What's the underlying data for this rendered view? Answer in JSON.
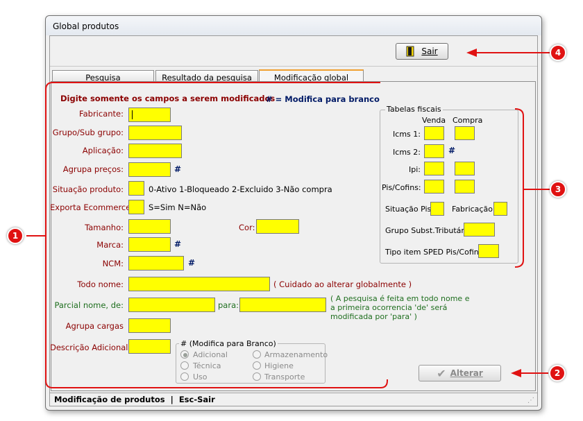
{
  "window": {
    "title": "Global produtos"
  },
  "toolbar": {
    "sair_label": "Sair"
  },
  "tabs": [
    {
      "label": "Pesquisa"
    },
    {
      "label": "Resultado da pesquisa"
    },
    {
      "label": "Modificação global"
    }
  ],
  "form": {
    "instruction": "Digite somente os campos a serem modificados",
    "hash_hint": "# = Modifica para branco",
    "fabricante": "Fabricante:",
    "grupo_sub": "Grupo/Sub grupo:",
    "aplicacao": "Aplicação:",
    "agrupa_precos": "Agrupa preços:",
    "situacao_produto": "Situação produto:",
    "situacao_help": "0-Ativo 1-Bloqueado 2-Excluido 3-Não compra",
    "exporta": "Exporta Ecommerce:",
    "exporta_help": "S=Sim  N=Não",
    "tamanho": "Tamanho:",
    "cor": "Cor:",
    "marca": "Marca:",
    "ncm": "NCM:",
    "todo_nome": "Todo nome:",
    "todo_nome_help": "( Cuidado ao alterar globalmente )",
    "parcial": "Parcial nome, de:",
    "para": "para:",
    "parcial_help_1": "( A pesquisa é feita em todo nome e",
    "parcial_help_2": "a primeira ocorrencia 'de' será",
    "parcial_help_3": "modificada por 'para' )",
    "agrupa_cargas": "Agrupa cargas",
    "descricao": "Descrição Adicional:",
    "hash": "#"
  },
  "radio_group": {
    "legend": "# (Modifica para Branco)",
    "options": [
      "Adicional",
      "Técnica",
      "Uso",
      "Armazenamento",
      "Higiene",
      "Transporte"
    ],
    "selected": "Adicional"
  },
  "fiscal": {
    "legend": "Tabelas fiscais",
    "venda": "Venda",
    "compra": "Compra",
    "icms1": "Icms 1:",
    "icms2": "Icms 2:",
    "ipi": "Ipi:",
    "piscofins": "Pis/Cofins:",
    "situacao_pis": "Situação Pis:",
    "fabricacao": "Fabricação:",
    "grupo_subst": "Grupo Subst.Tributária:",
    "tipo_item": "Tipo item SPED Pis/Cofins:"
  },
  "actions": {
    "alterar_label": "Alterar"
  },
  "status": {
    "text": "Modificação de produtos  |  Esc-Sair"
  },
  "callouts": [
    "1",
    "2",
    "3",
    "4"
  ],
  "colors": {
    "field": "#ffff00",
    "callout": "#e01212",
    "tab_accent": "#f0a030"
  }
}
